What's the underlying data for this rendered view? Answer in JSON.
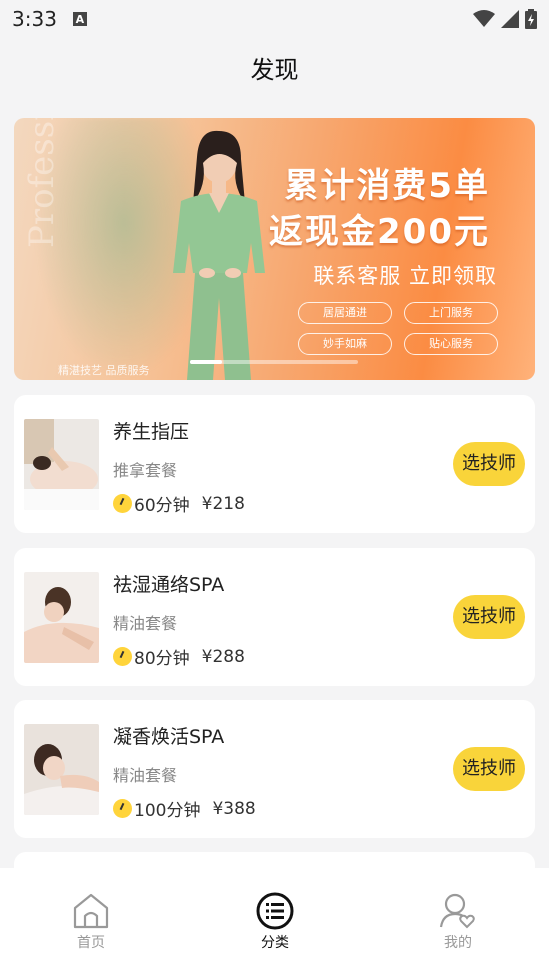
{
  "status_bar": {
    "time": "3:33",
    "notification_icon": "A"
  },
  "header": {
    "title": "发现"
  },
  "banner": {
    "side_text": "Professional",
    "promo_line1": "累计消费5单",
    "promo_line2": "返现金200元",
    "promo_line3": "联系客服 立即领取",
    "tags": [
      "居居通进",
      "上门服务",
      "妙手如麻",
      "贴心服务"
    ],
    "footer_text": "精湛技艺 品质服务"
  },
  "services": [
    {
      "title": "养生指压",
      "subtitle": "推拿套餐",
      "duration": "60分钟",
      "price": "¥218",
      "button": "选技师"
    },
    {
      "title": "祛湿通络SPA",
      "subtitle": "精油套餐",
      "duration": "80分钟",
      "price": "¥288",
      "button": "选技师"
    },
    {
      "title": "凝香焕活SPA",
      "subtitle": "精油套餐",
      "duration": "100分钟",
      "price": "¥388",
      "button": "选技师"
    }
  ],
  "tabbar": {
    "items": [
      {
        "label": "首页",
        "icon": "home-icon",
        "active": false
      },
      {
        "label": "分类",
        "icon": "category-list-icon",
        "active": true
      },
      {
        "label": "我的",
        "icon": "profile-heart-icon",
        "active": false
      }
    ]
  },
  "colors": {
    "accent": "#f9d43a",
    "background": "#f4f4f5",
    "banner_orange": "#fb8c43"
  }
}
